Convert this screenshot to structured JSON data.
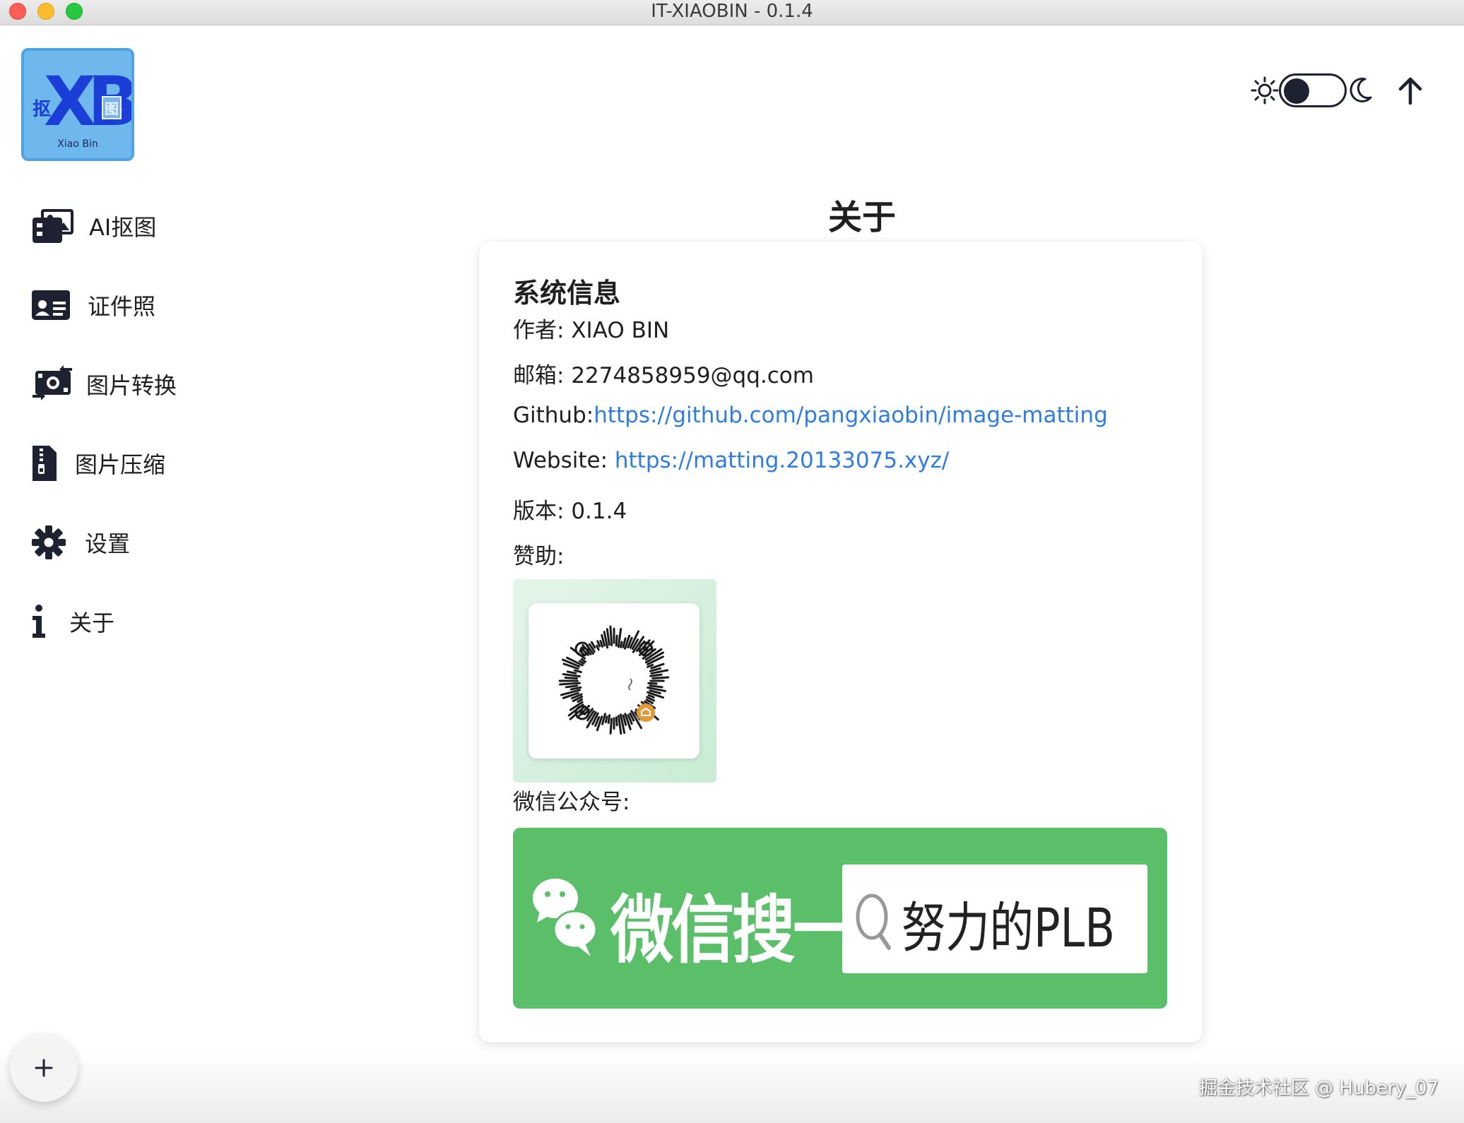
{
  "window": {
    "title": "IT-XIAOBIN - 0.1.4"
  },
  "logo": {
    "big_text": "XB",
    "left_char": "抠",
    "right_char": "图",
    "caption": "Xiao Bin"
  },
  "sidebar": {
    "items": [
      {
        "label": "AI抠图",
        "icon": "photo-images-icon"
      },
      {
        "label": "证件照",
        "icon": "id-card-icon"
      },
      {
        "label": "图片转换",
        "icon": "money-exchange-icon"
      },
      {
        "label": "图片压缩",
        "icon": "file-zipper-icon"
      },
      {
        "label": "设置",
        "icon": "gear-icon"
      },
      {
        "label": "关于",
        "icon": "info-icon"
      }
    ]
  },
  "header": {
    "theme_toggle": "light",
    "icons": [
      "sun-icon",
      "moon-icon",
      "arrow-up-icon"
    ]
  },
  "main": {
    "title": "关于",
    "card": {
      "title": "系统信息",
      "author_label": "作者: ",
      "author_value": "XIAO BIN",
      "email_label": "邮箱: ",
      "email_value": "2274858959@qq.com",
      "github_label": "Github:",
      "github_link": "https://github.com/pangxiaobin/image-matting",
      "website_label": "Website: ",
      "website_link": "https://matting.20133075.xyz/",
      "version_label": "版本: ",
      "version_value": "0.1.4",
      "sponsor_label": "赞助:",
      "wechat_label": "微信公众号:",
      "wechat_banner_text": "微信搜一搜",
      "wechat_search_value": "努力的PLB"
    }
  },
  "watermark": "掘金技术社区 @ Hubery_07",
  "colors": {
    "accent_link": "#2f7de1",
    "wechat_green": "#5bbf6a",
    "logo_blue": "#1b3fd6",
    "logo_bg": "#6fb8ee"
  }
}
